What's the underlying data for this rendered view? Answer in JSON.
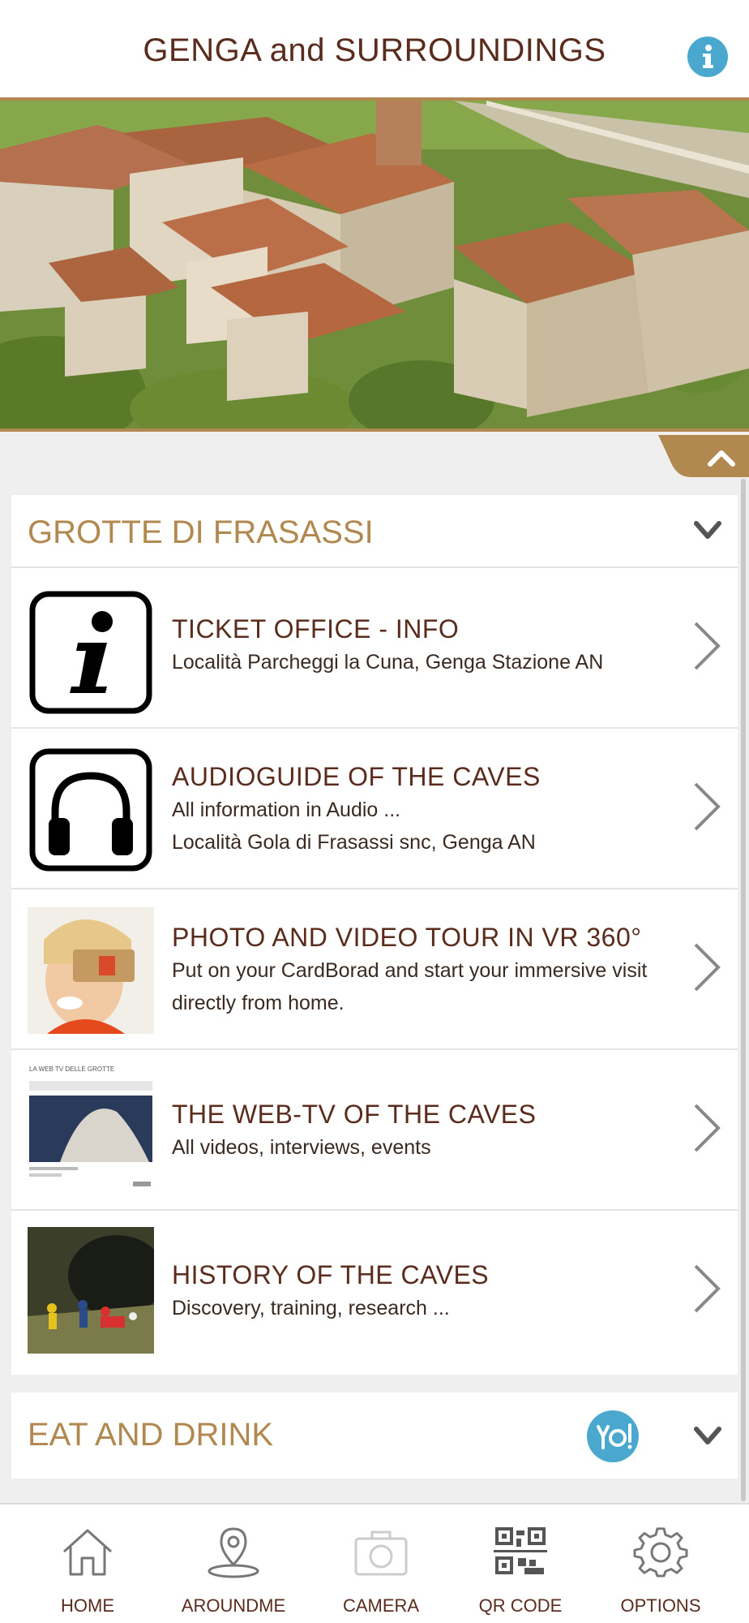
{
  "header": {
    "title": "GENGA and SURROUNDINGS",
    "info_icon": "info-icon"
  },
  "hero": {
    "image": "aerial-photo-genga-village"
  },
  "sections": [
    {
      "title": "GROTTE DI FRASASSI",
      "items": [
        {
          "title": "TICKET OFFICE - INFO",
          "subtitle": [
            "Località Parcheggi la Cuna, Genga Stazione AN"
          ],
          "thumb": "info-icon"
        },
        {
          "title": "AUDIOGUIDE OF THE CAVES",
          "subtitle": [
            "All information in Audio ...",
            "Località Gola di Frasassi snc, Genga AN"
          ],
          "thumb": "headphones-icon"
        },
        {
          "title": "PHOTO AND VIDEO TOUR IN VR 360°",
          "subtitle": [
            "Put on your CardBorad and start your immersive visit",
            "directly from home."
          ],
          "thumb": "vr-cardboard-photo"
        },
        {
          "title": "THE WEB-TV OF THE CAVES",
          "subtitle": [
            "All videos, interviews, events"
          ],
          "thumb": "web-tv-screenshot",
          "thumb_text": "LA WEB TV DELLE GROTTE"
        },
        {
          "title": "HISTORY OF THE CAVES",
          "subtitle": [
            "Discovery, training, research ..."
          ],
          "thumb": "cave-explorers-photo"
        }
      ]
    },
    {
      "title": "EAT AND DRINK",
      "icon": "restaurant-icon"
    }
  ],
  "bottom_nav": [
    {
      "label": "HOME",
      "icon": "home-icon"
    },
    {
      "label": "AROUNDME",
      "icon": "location-pin-icon"
    },
    {
      "label": "CAMERA",
      "icon": "camera-icon"
    },
    {
      "label": "QR CODE",
      "icon": "qr-code-icon"
    },
    {
      "label": "OPTIONS",
      "icon": "gear-icon"
    }
  ],
  "colors": {
    "accent_gold": "#b08850",
    "title_brown": "#5a2c1e",
    "info_blue": "#4aa8cf",
    "background": "#efefef"
  }
}
